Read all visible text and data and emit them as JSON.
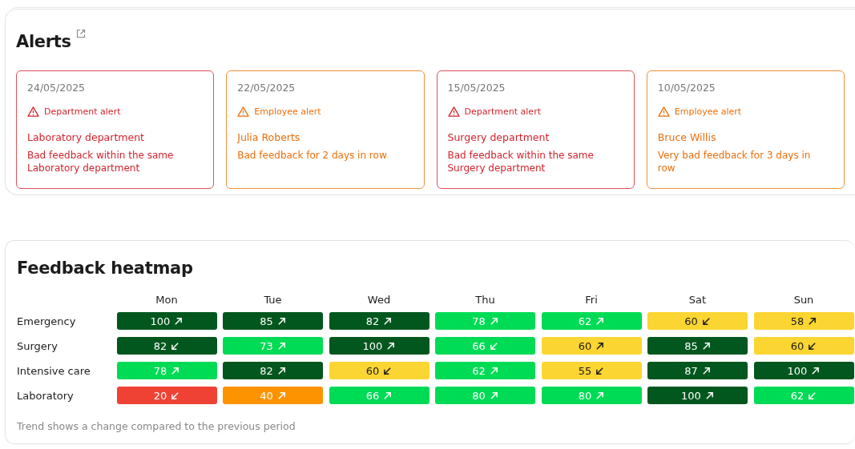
{
  "alerts": {
    "title": "Alerts",
    "cards": [
      {
        "kind": "department",
        "date": "24/05/2025",
        "type_label": "Department alert",
        "subject": "Laboratory department",
        "message": "Bad feedback within the same Laboratory department"
      },
      {
        "kind": "employee",
        "date": "22/05/2025",
        "type_label": "Employee alert",
        "subject": "Julia Roberts",
        "message": "Bad feedback for 2 days in row"
      },
      {
        "kind": "department",
        "date": "15/05/2025",
        "type_label": "Department alert",
        "subject": "Surgery department",
        "message": "Bad feedback within the same Surgery department"
      },
      {
        "kind": "employee",
        "date": "10/05/2025",
        "type_label": "Employee alert",
        "subject": "Bruce Willis",
        "message": "Very bad feedback for 3 days in row"
      }
    ]
  },
  "heatmap": {
    "title": "Feedback heatmap",
    "columns": [
      "Mon",
      "Tue",
      "Wed",
      "Thu",
      "Fri",
      "Sat",
      "Sun"
    ],
    "rows": [
      {
        "label": "Emergency",
        "cells": [
          {
            "value": "100",
            "rising": true,
            "color": "#02571f"
          },
          {
            "value": "85",
            "rising": true,
            "color": "#02571f"
          },
          {
            "value": "82",
            "rising": true,
            "color": "#02571f"
          },
          {
            "value": "78",
            "rising": true,
            "color": "#00db56"
          },
          {
            "value": "62",
            "rising": true,
            "color": "#00db56"
          },
          {
            "value": "60",
            "rising": false,
            "color": "#fbd531"
          },
          {
            "value": "58",
            "rising": true,
            "color": "#fbd531"
          }
        ]
      },
      {
        "label": "Surgery",
        "cells": [
          {
            "value": "82",
            "rising": false,
            "color": "#02571f"
          },
          {
            "value": "73",
            "rising": true,
            "color": "#00db56"
          },
          {
            "value": "100",
            "rising": true,
            "color": "#02571f"
          },
          {
            "value": "66",
            "rising": false,
            "color": "#00db56"
          },
          {
            "value": "60",
            "rising": true,
            "color": "#fbd531"
          },
          {
            "value": "85",
            "rising": true,
            "color": "#02571f"
          },
          {
            "value": "60",
            "rising": false,
            "color": "#fbd531"
          }
        ]
      },
      {
        "label": "Intensive care",
        "cells": [
          {
            "value": "78",
            "rising": true,
            "color": "#00db56"
          },
          {
            "value": "82",
            "rising": true,
            "color": "#02571f"
          },
          {
            "value": "60",
            "rising": false,
            "color": "#fbd531"
          },
          {
            "value": "62",
            "rising": true,
            "color": "#00db56"
          },
          {
            "value": "55",
            "rising": false,
            "color": "#fbd531"
          },
          {
            "value": "87",
            "rising": true,
            "color": "#02571f"
          },
          {
            "value": "100",
            "rising": true,
            "color": "#02571f"
          }
        ]
      },
      {
        "label": "Laboratory",
        "cells": [
          {
            "value": "20",
            "rising": false,
            "color": "#f04234"
          },
          {
            "value": "40",
            "rising": true,
            "color": "#fd9300"
          },
          {
            "value": "66",
            "rising": true,
            "color": "#00db56"
          },
          {
            "value": "80",
            "rising": true,
            "color": "#00db56"
          },
          {
            "value": "80",
            "rising": true,
            "color": "#00db56"
          },
          {
            "value": "100",
            "rising": true,
            "color": "#02571f"
          },
          {
            "value": "62",
            "rising": false,
            "color": "#00db56"
          }
        ]
      }
    ],
    "footnote": "Trend shows a change compared to the previous period"
  }
}
